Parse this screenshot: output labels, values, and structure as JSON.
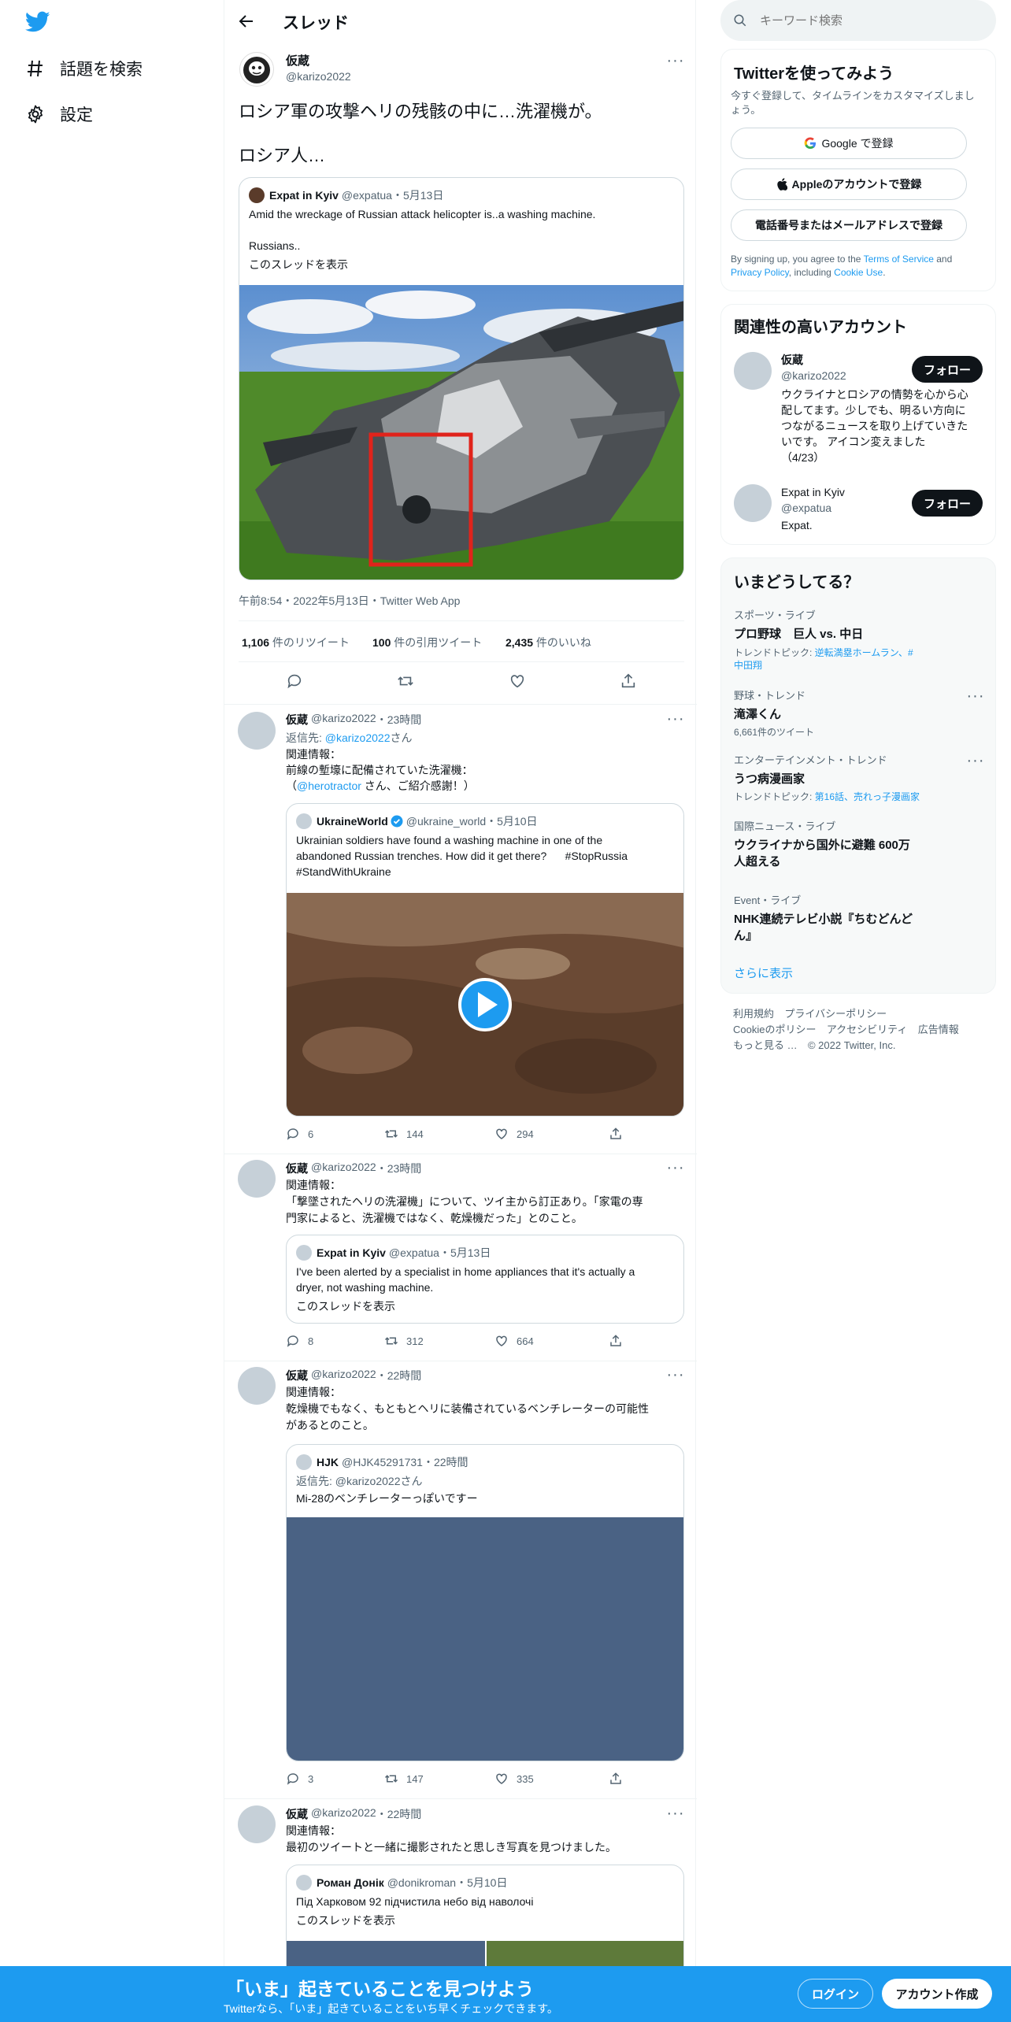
{
  "nav": {
    "explore": "話題を検索",
    "settings": "設定"
  },
  "header": {
    "title": "スレッド"
  },
  "main_tweet": {
    "name": "仮蔵",
    "handle": "@karizo2022",
    "text_line1": "ロシア軍の攻撃ヘリの残骸の中に…洗濯機が。",
    "text_line2": "ロシア人…",
    "quote": {
      "name": "Expat in Kyiv",
      "handle": "@expatua",
      "date": "・5月13日",
      "text1": "Amid the wreckage of Russian attack helicopter is..a washing machine.",
      "text2": "Russians..",
      "link": "このスレッドを表示"
    },
    "meta": "午前8:54・2022年5月13日・Twitter Web App",
    "retweets": "1,106",
    "retweets_label": " 件のリツイート",
    "quotes": "100",
    "quotes_label": " 件の引用ツイート",
    "likes": "2,435",
    "likes_label": " 件のいいね"
  },
  "replies": [
    {
      "name": "仮蔵",
      "handle": "@karizo2022",
      "time": "・23時間",
      "reply_prefix": "返信先: ",
      "reply_to": "@karizo2022",
      "reply_suffix": "さん",
      "line1": "関連情報：",
      "line2": "前線の塹壕に配備されていた洗濯機：",
      "line3_a": "（",
      "line3_link": "@herotractor",
      "line3_b": " さん、ご紹介感謝！）",
      "quote": {
        "name": "UkraineWorld",
        "handle": "@ukraine_world",
        "date": "・5月10日",
        "text1": "Ukrainian soldiers have found a washing machine in one of the",
        "text2": "abandoned Russian trenches. How did it get there?      #StopRussia",
        "text3": "#StandWithUkraine"
      },
      "replies": "6",
      "retweets": "144",
      "likes": "294"
    },
    {
      "name": "仮蔵",
      "handle": "@karizo2022",
      "time": "・23時間",
      "line1": "関連情報：",
      "line2": "「撃墜されたヘリの洗濯機」について、ツイ主から訂正あり。「家電の専",
      "line3": "門家によると、洗濯機ではなく、乾燥機だった」とのこと。",
      "quote": {
        "name": "Expat in Kyiv",
        "handle": "@expatua",
        "date": "・5月13日",
        "text1": "I've been alerted by a specialist in home appliances that it's actually a",
        "text2": "dryer, not washing machine.",
        "link": "このスレッドを表示"
      },
      "replies": "8",
      "retweets": "312",
      "likes": "664"
    },
    {
      "name": "仮蔵",
      "handle": "@karizo2022",
      "time": "・22時間",
      "line1": "関連情報：",
      "line2": "乾燥機でもなく、もともとヘリに装備されているベンチレーターの可能性",
      "line3": "があるとのこと。",
      "quote": {
        "name": "HJK",
        "handle": "@HJK45291731",
        "date": "・22時間",
        "reply_line": "返信先: @karizo2022さん",
        "text1": "Mi-28のベンチレーターっぽいですー"
      },
      "replies": "3",
      "retweets": "147",
      "likes": "335"
    },
    {
      "name": "仮蔵",
      "handle": "@karizo2022",
      "time": "・22時間",
      "line1": "関連情報：",
      "line2": "最初のツイートと一緒に撮影されたと思しき写真を見つけました。",
      "quote": {
        "name": "Роман Донік",
        "handle": "@donikroman",
        "date": "・5月10日",
        "text1": "Під Харковом 92 підчистила небо від наволочі",
        "link": "このスレッドを表示"
      }
    }
  ],
  "search": {
    "placeholder": "キーワード検索"
  },
  "signup": {
    "title": "Twitterを使ってみよう",
    "desc1": "今すぐ登録して、タイムラインをカスタマイズしまし",
    "desc2": "ょう。",
    "google": "Google で登録",
    "apple": "Appleのアカウントで登録",
    "phone": "電話番号またはメールアドレスで登録",
    "terms_a": "By signing up, you agree to the ",
    "terms_link1": "Terms of Service",
    "terms_b": " and",
    "terms_link2": "Privacy Policy",
    "terms_c": ", including ",
    "terms_link3": "Cookie Use",
    "terms_d": "."
  },
  "related": {
    "title": "関連性の高いアカウント",
    "accounts": [
      {
        "name": "仮蔵",
        "handle": "@karizo2022",
        "follow": "フォロー",
        "bio1": "ウクライナとロシアの情勢を心から心",
        "bio2": "配してます。少しでも、明るい方向に",
        "bio3": "つながるニュースを取り上げていきた",
        "bio4": "いです。 アイコン変えました",
        "bio5": "（4/23）"
      },
      {
        "name": "Expat in Kyiv",
        "handle": "@expatua",
        "follow": "フォロー",
        "bio1": "Expat."
      }
    ]
  },
  "trends": {
    "title": "いまどうしてる？",
    "items": [
      {
        "cat": "スポーツ・ライブ",
        "name": "プロ野球　巨人 vs. 中日",
        "sub_prefix": "トレンドトピック: ",
        "sub_link": "逆転満塁ホームラン",
        "sub2": "、#中田翔"
      },
      {
        "cat": "野球・トレンド",
        "name": "滝澤くん",
        "count": "6,661件のツイート"
      },
      {
        "cat": "エンターテインメント・トレンド",
        "name": "うつ病漫画家",
        "sub_prefix": "トレンドトピック: ",
        "sub_link": "第16話、売れっ子漫画家"
      },
      {
        "cat": "国際ニュース・ライブ",
        "name1": "ウクライナから国外に避難 600万",
        "name2": "人超える"
      },
      {
        "cat": "Event・ライブ",
        "name1": "NHK連続テレビ小説『ちむどんど",
        "name2": "ん』"
      }
    ],
    "more": "さらに表示"
  },
  "footer": {
    "l1": "利用規約",
    "l2": "プライバシーポリシー",
    "l3": "Cookieのポリシー",
    "l4": "アクセシビリティ",
    "l5": "広告情報",
    "l6": "もっと見る …",
    "copy": "© 2022 Twitter, Inc."
  },
  "banner": {
    "title": "「いま」起きていることを見つけよう",
    "sub": "Twitterなら、「いま」起きていることをいち早くチェックできます。",
    "login": "ログイン",
    "signup": "アカウント作成"
  },
  "colors": {
    "brand": "#1d9bf0",
    "text": "#0f1419",
    "muted": "#536471",
    "media_placeholder": "#4a6284"
  }
}
